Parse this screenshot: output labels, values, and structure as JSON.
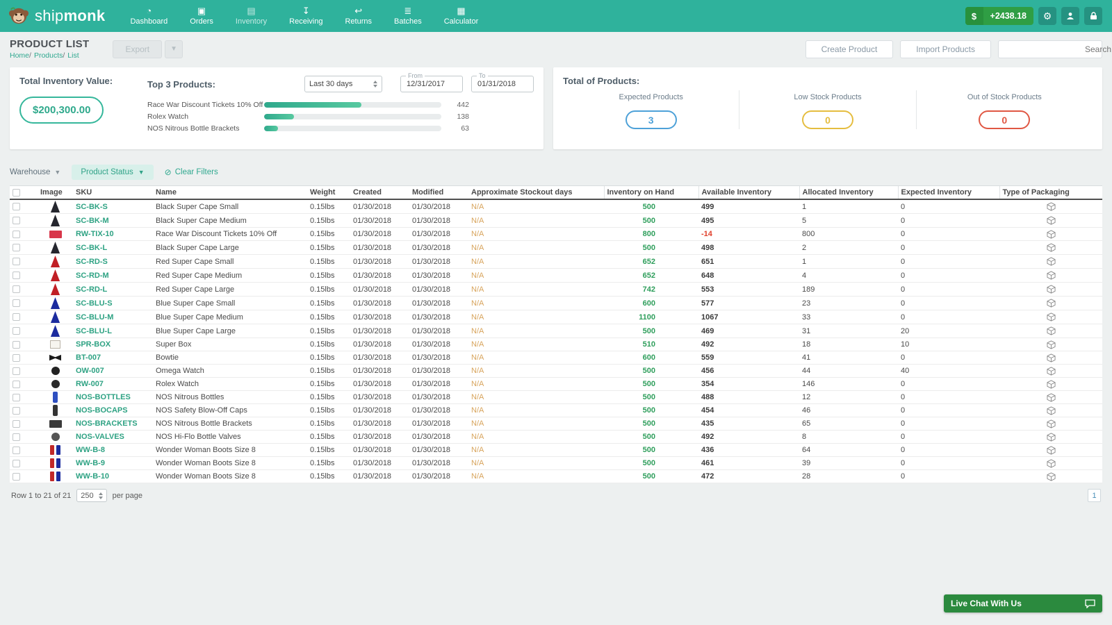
{
  "nav": {
    "brand_ship": "ship",
    "brand_monk": "monk",
    "items": [
      {
        "label": "Dashboard",
        "icon": "dashboard-icon",
        "active": false
      },
      {
        "label": "Orders",
        "icon": "orders-icon",
        "active": false
      },
      {
        "label": "Inventory",
        "icon": "inventory-icon",
        "active": true
      },
      {
        "label": "Receiving",
        "icon": "receiving-icon",
        "active": false
      },
      {
        "label": "Returns",
        "icon": "returns-icon",
        "active": false
      },
      {
        "label": "Batches",
        "icon": "batches-icon",
        "active": false
      },
      {
        "label": "Calculator",
        "icon": "calculator-icon",
        "active": false
      }
    ],
    "balance_currency": "$",
    "balance": "+2438.18"
  },
  "header": {
    "title": "PRODUCT LIST",
    "breadcrumb": [
      "Home",
      "Products",
      "List"
    ],
    "export_label": "Export",
    "create_product_label": "Create Product",
    "import_products_label": "Import Products",
    "search_placeholder": "Search"
  },
  "summary": {
    "inventory_value_label": "Total Inventory Value:",
    "inventory_value": "$200,300.00",
    "top_products_label": "Top 3 Products:",
    "range_value": "Last 30 days",
    "from_label": "From",
    "from_value": "12/31/2017",
    "to_label": "To",
    "to_value": "01/31/2018",
    "chart_data": {
      "type": "bar",
      "categories": [
        "Race War Discount Tickets 10% Off",
        "Rolex Watch",
        "NOS Nitrous Bottle Brackets"
      ],
      "values": [
        442,
        138,
        63
      ],
      "xlim": [
        0,
        800
      ]
    },
    "totals_label": "Total of Products:",
    "stats": [
      {
        "label": "Expected Products",
        "value": "3",
        "color": "#4da1d8"
      },
      {
        "label": "Low Stock Products",
        "value": "0",
        "color": "#e5bd3f"
      },
      {
        "label": "Out of Stock Products",
        "value": "0",
        "color": "#e05743"
      }
    ]
  },
  "filters": {
    "warehouse_label": "Warehouse",
    "product_status_label": "Product Status",
    "clear_filters_label": "Clear Filters"
  },
  "table": {
    "columns": [
      "Image",
      "SKU",
      "Name",
      "Weight",
      "Created",
      "Modified",
      "Approximate Stockout days",
      "Inventory on Hand",
      "Available Inventory",
      "Allocated Inventory",
      "Expected Inventory",
      "Type of Packaging"
    ],
    "rows": [
      {
        "sku": "SC-BK-S",
        "name": "Black Super Cape Small",
        "weight": "0.15lbs",
        "created": "01/30/2018",
        "modified": "01/30/2018",
        "stockout": "N/A",
        "on_hand": "500",
        "available": "499",
        "available_negative": false,
        "allocated": "1",
        "expected": "0",
        "thumb_shape": "cape",
        "thumb_color": "#25262e"
      },
      {
        "sku": "SC-BK-M",
        "name": "Black Super Cape Medium",
        "weight": "0.15lbs",
        "created": "01/30/2018",
        "modified": "01/30/2018",
        "stockout": "N/A",
        "on_hand": "500",
        "available": "495",
        "available_negative": false,
        "allocated": "5",
        "expected": "0",
        "thumb_shape": "cape",
        "thumb_color": "#25262e"
      },
      {
        "sku": "RW-TIX-10",
        "name": "Race War Discount Tickets 10% Off",
        "weight": "0.15lbs",
        "created": "01/30/2018",
        "modified": "01/30/2018",
        "stockout": "N/A",
        "on_hand": "800",
        "available": "-14",
        "available_negative": true,
        "allocated": "800",
        "expected": "0",
        "thumb_shape": "rect",
        "thumb_color": "#d8364a"
      },
      {
        "sku": "SC-BK-L",
        "name": "Black Super Cape Large",
        "weight": "0.15lbs",
        "created": "01/30/2018",
        "modified": "01/30/2018",
        "stockout": "N/A",
        "on_hand": "500",
        "available": "498",
        "available_negative": false,
        "allocated": "2",
        "expected": "0",
        "thumb_shape": "cape",
        "thumb_color": "#25262e"
      },
      {
        "sku": "SC-RD-S",
        "name": "Red Super Cape Small",
        "weight": "0.15lbs",
        "created": "01/30/2018",
        "modified": "01/30/2018",
        "stockout": "N/A",
        "on_hand": "652",
        "available": "651",
        "available_negative": false,
        "allocated": "1",
        "expected": "0",
        "thumb_shape": "cape",
        "thumb_color": "#c01f25"
      },
      {
        "sku": "SC-RD-M",
        "name": "Red Super Cape Medium",
        "weight": "0.15lbs",
        "created": "01/30/2018",
        "modified": "01/30/2018",
        "stockout": "N/A",
        "on_hand": "652",
        "available": "648",
        "available_negative": false,
        "allocated": "4",
        "expected": "0",
        "thumb_shape": "cape",
        "thumb_color": "#c01f25"
      },
      {
        "sku": "SC-RD-L",
        "name": "Red Super Cape Large",
        "weight": "0.15lbs",
        "created": "01/30/2018",
        "modified": "01/30/2018",
        "stockout": "N/A",
        "on_hand": "742",
        "available": "553",
        "available_negative": false,
        "allocated": "189",
        "expected": "0",
        "thumb_shape": "cape",
        "thumb_color": "#c01f25"
      },
      {
        "sku": "SC-BLU-S",
        "name": "Blue Super Cape Small",
        "weight": "0.15lbs",
        "created": "01/30/2018",
        "modified": "01/30/2018",
        "stockout": "N/A",
        "on_hand": "600",
        "available": "577",
        "available_negative": false,
        "allocated": "23",
        "expected": "0",
        "thumb_shape": "cape",
        "thumb_color": "#1b2b9e"
      },
      {
        "sku": "SC-BLU-M",
        "name": "Blue Super Cape Medium",
        "weight": "0.15lbs",
        "created": "01/30/2018",
        "modified": "01/30/2018",
        "stockout": "N/A",
        "on_hand": "1100",
        "available": "1067",
        "available_negative": false,
        "allocated": "33",
        "expected": "0",
        "thumb_shape": "cape",
        "thumb_color": "#1b2b9e"
      },
      {
        "sku": "SC-BLU-L",
        "name": "Blue Super Cape Large",
        "weight": "0.15lbs",
        "created": "01/30/2018",
        "modified": "01/30/2018",
        "stockout": "N/A",
        "on_hand": "500",
        "available": "469",
        "available_negative": false,
        "allocated": "31",
        "expected": "20",
        "thumb_shape": "cape",
        "thumb_color": "#1b2b9e"
      },
      {
        "sku": "SPR-BOX",
        "name": "Super Box",
        "weight": "0.15lbs",
        "created": "01/30/2018",
        "modified": "01/30/2018",
        "stockout": "N/A",
        "on_hand": "510",
        "available": "492",
        "available_negative": false,
        "allocated": "18",
        "expected": "10",
        "thumb_shape": "box",
        "thumb_color": "#f7f5ef"
      },
      {
        "sku": "BT-007",
        "name": "Bowtie",
        "weight": "0.15lbs",
        "created": "01/30/2018",
        "modified": "01/30/2018",
        "stockout": "N/A",
        "on_hand": "600",
        "available": "559",
        "available_negative": false,
        "allocated": "41",
        "expected": "0",
        "thumb_shape": "bowtie",
        "thumb_color": "#1c1c1c"
      },
      {
        "sku": "OW-007",
        "name": "Omega Watch",
        "weight": "0.15lbs",
        "created": "01/30/2018",
        "modified": "01/30/2018",
        "stockout": "N/A",
        "on_hand": "500",
        "available": "456",
        "available_negative": false,
        "allocated": "44",
        "expected": "40",
        "thumb_shape": "circle",
        "thumb_color": "#222222"
      },
      {
        "sku": "RW-007",
        "name": "Rolex Watch",
        "weight": "0.15lbs",
        "created": "01/30/2018",
        "modified": "01/30/2018",
        "stockout": "N/A",
        "on_hand": "500",
        "available": "354",
        "available_negative": false,
        "allocated": "146",
        "expected": "0",
        "thumb_shape": "circle",
        "thumb_color": "#2a2a2a"
      },
      {
        "sku": "NOS-BOTTLES",
        "name": "NOS Nitrous Bottles",
        "weight": "0.15lbs",
        "created": "01/30/2018",
        "modified": "01/30/2018",
        "stockout": "N/A",
        "on_hand": "500",
        "available": "488",
        "available_negative": false,
        "allocated": "12",
        "expected": "0",
        "thumb_shape": "bottle",
        "thumb_color": "#2e4fc0"
      },
      {
        "sku": "NOS-BOCAPS",
        "name": "NOS Safety Blow-Off Caps",
        "weight": "0.15lbs",
        "created": "01/30/2018",
        "modified": "01/30/2018",
        "stockout": "N/A",
        "on_hand": "500",
        "available": "454",
        "available_negative": false,
        "allocated": "46",
        "expected": "0",
        "thumb_shape": "bottle",
        "thumb_color": "#333333"
      },
      {
        "sku": "NOS-BRACKETS",
        "name": "NOS Nitrous Bottle Brackets",
        "weight": "0.15lbs",
        "created": "01/30/2018",
        "modified": "01/30/2018",
        "stockout": "N/A",
        "on_hand": "500",
        "available": "435",
        "available_negative": false,
        "allocated": "65",
        "expected": "0",
        "thumb_shape": "rect",
        "thumb_color": "#3a3a3a"
      },
      {
        "sku": "NOS-VALVES",
        "name": "NOS Hi-Flo Bottle Valves",
        "weight": "0.15lbs",
        "created": "01/30/2018",
        "modified": "01/30/2018",
        "stockout": "N/A",
        "on_hand": "500",
        "available": "492",
        "available_negative": false,
        "allocated": "8",
        "expected": "0",
        "thumb_shape": "circle",
        "thumb_color": "#555555"
      },
      {
        "sku": "WW-B-8",
        "name": "Wonder Woman Boots Size 8",
        "weight": "0.15lbs",
        "created": "01/30/2018",
        "modified": "01/30/2018",
        "stockout": "N/A",
        "on_hand": "500",
        "available": "436",
        "available_negative": false,
        "allocated": "64",
        "expected": "0",
        "thumb_shape": "boots",
        "thumb_color": "#c02828"
      },
      {
        "sku": "WW-B-9",
        "name": "Wonder Woman Boots Size 8",
        "weight": "0.15lbs",
        "created": "01/30/2018",
        "modified": "01/30/2018",
        "stockout": "N/A",
        "on_hand": "500",
        "available": "461",
        "available_negative": false,
        "allocated": "39",
        "expected": "0",
        "thumb_shape": "boots",
        "thumb_color": "#c02828"
      },
      {
        "sku": "WW-B-10",
        "name": "Wonder Woman Boots Size 8",
        "weight": "0.15lbs",
        "created": "01/30/2018",
        "modified": "01/30/2018",
        "stockout": "N/A",
        "on_hand": "500",
        "available": "472",
        "available_negative": false,
        "allocated": "28",
        "expected": "0",
        "thumb_shape": "boots",
        "thumb_color": "#c02828"
      }
    ]
  },
  "footer": {
    "row_info": "Row 1 to 21 of 21",
    "per_page_value": "250",
    "per_page_label": "per page",
    "page_number": "1"
  },
  "chat": {
    "label": "Live Chat With Us"
  }
}
